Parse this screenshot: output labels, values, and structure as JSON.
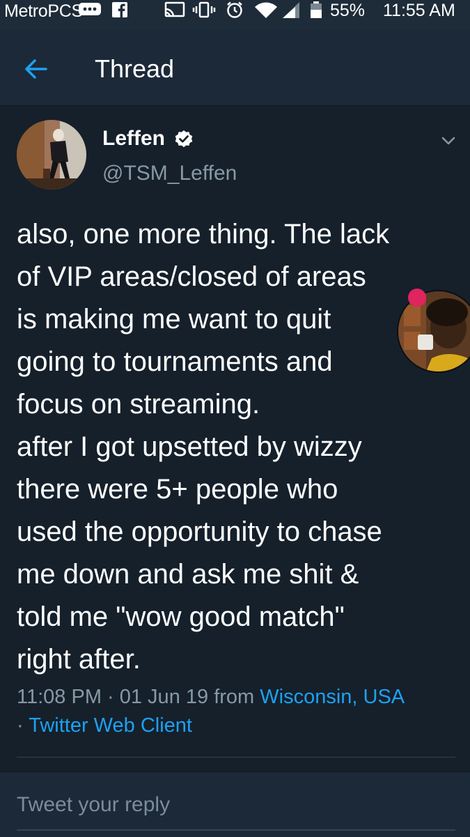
{
  "status_bar": {
    "carrier": "MetroPCS",
    "battery": "55%",
    "time": "11:55 AM",
    "icons": [
      "chat-bubble-icon",
      "facebook-icon",
      "cast-icon",
      "vibrate-icon",
      "alarm-icon",
      "wifi-icon",
      "signal-icon",
      "battery-icon"
    ]
  },
  "header": {
    "title": "Thread",
    "back_icon": "arrow-left-icon"
  },
  "tweet": {
    "author_name": "Leffen",
    "handle": "@TSM_Leffen",
    "verified": true,
    "text_lines": [
      "also, one more thing. The lack",
      "of VIP areas/closed of areas",
      "is making me want to quit",
      "going to tournaments and",
      "focus on streaming.",
      "after I got upsetted by wizzy",
      "there were 5+ people who",
      "used the opportunity to chase",
      "me down and ask me shit &",
      "told me \"wow good match\"",
      "right after."
    ],
    "timestamp": "11:08 PM · 01 Jun 19 from",
    "location": "Wisconsin, USA",
    "separator": "·",
    "client": "Twitter Web Client"
  },
  "reply": {
    "placeholder": "Tweet your reply"
  },
  "colors": {
    "background": "#15202b",
    "header": "#1c2938",
    "accent": "#1da1f2",
    "muted": "#8899a6"
  }
}
